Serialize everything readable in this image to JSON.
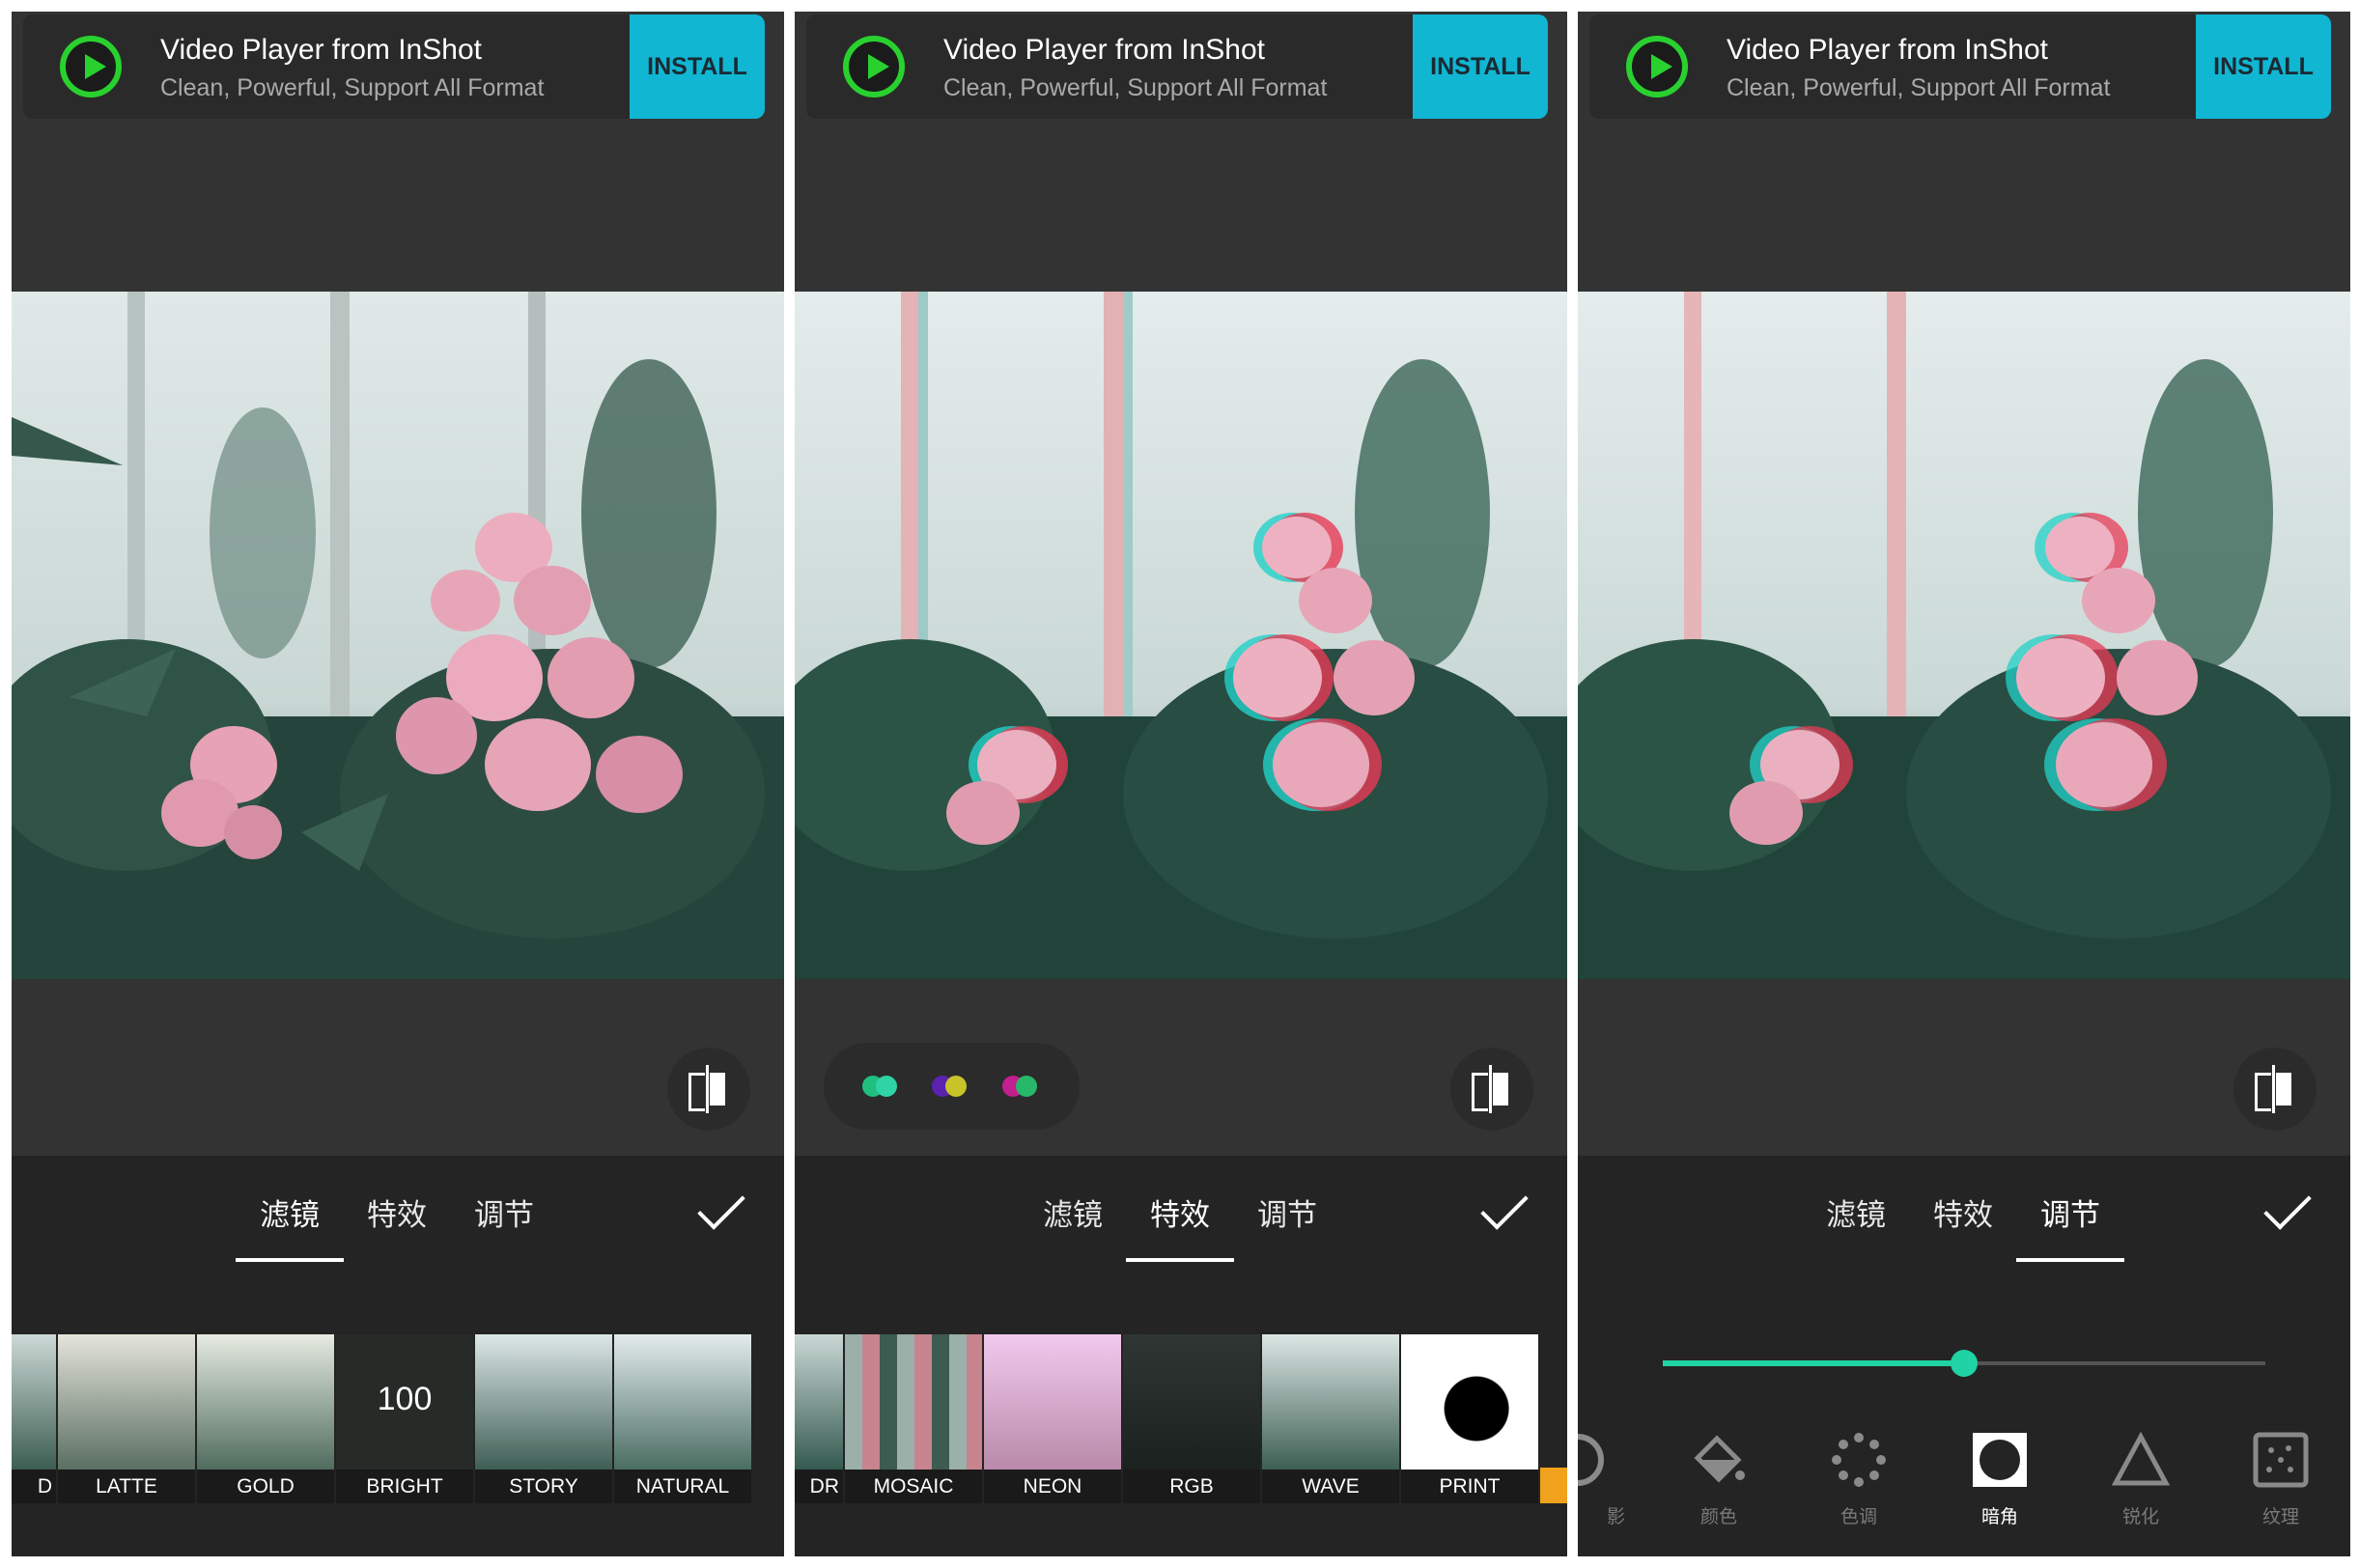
{
  "ad": {
    "title": "Video Player from InShot",
    "subtitle": "Clean, Powerful, Support All Format",
    "install_label": "INSTALL",
    "accent": "#10b6d2",
    "icon_color": "#29d12f"
  },
  "tabs": {
    "filter": "滤镜",
    "effect": "特效",
    "adjust": "调节"
  },
  "panels": [
    {
      "active_tab": "filter"
    },
    {
      "active_tab": "effect"
    },
    {
      "active_tab": "adjust"
    }
  ],
  "filters": {
    "items": [
      {
        "label": "D"
      },
      {
        "label": "LATTE"
      },
      {
        "label": "GOLD"
      },
      {
        "label": "BRIGHT",
        "value": "100"
      },
      {
        "label": "STORY"
      },
      {
        "label": "NATURAL"
      }
    ]
  },
  "effects": {
    "items": [
      {
        "label": "DR"
      },
      {
        "label": "MOSAIC"
      },
      {
        "label": "NEON"
      },
      {
        "label": "RGB"
      },
      {
        "label": "WAVE"
      },
      {
        "label": "PRINT"
      }
    ],
    "color_pairs": [
      {
        "a": "#1fbf7f",
        "b": "#2fd3a6"
      },
      {
        "a": "#5b22b0",
        "b": "#c9c32a"
      },
      {
        "a": "#c21f8f",
        "b": "#28b86a"
      }
    ]
  },
  "adjust": {
    "slider_value_fraction": 0.5,
    "slider_color": "#1fd3a4",
    "tools": [
      {
        "label": "影",
        "icon": "shadow-icon"
      },
      {
        "label": "颜色",
        "icon": "paint-bucket-icon"
      },
      {
        "label": "色调",
        "icon": "hue-dots-icon"
      },
      {
        "label": "暗角",
        "icon": "vignette-icon",
        "active": true
      },
      {
        "label": "锐化",
        "icon": "sharpen-triangle-icon"
      },
      {
        "label": "纹理",
        "icon": "grain-icon"
      }
    ]
  }
}
